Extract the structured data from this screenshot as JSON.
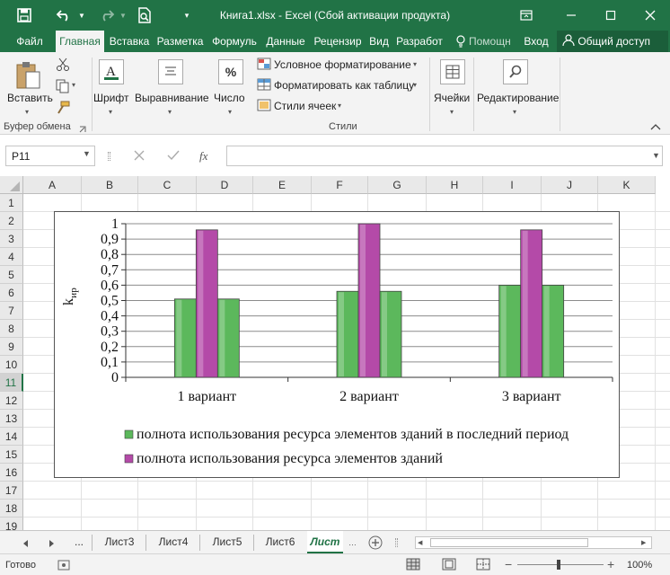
{
  "window": {
    "title": "Книга1.xlsx - Excel (Сбой активации продукта)"
  },
  "ribbon_tabs": [
    "Файл",
    "Главная",
    "Вставка",
    "Разметка",
    "Формуль",
    "Данные",
    "Рецензир",
    "Вид",
    "Разработ",
    "Помощн",
    "Вход"
  ],
  "share_label": "Общий доступ",
  "ribbon": {
    "paste_label": "Вставить",
    "clipboard_group": "Буфер обмена",
    "font_label": "Шрифт",
    "align_label": "Выравнивание",
    "number_label": "Число",
    "cond_format": "Условное форматирование",
    "format_table": "Форматировать как таблицу",
    "cell_styles": "Стили ячеек",
    "styles_group": "Стили",
    "cells_label": "Ячейки",
    "editing_label": "Редактирование"
  },
  "formula_bar": {
    "name_box": "P11",
    "fx": "fx",
    "formula": ""
  },
  "columns": [
    "A",
    "B",
    "C",
    "D",
    "E",
    "F",
    "G",
    "H",
    "I",
    "J",
    "K"
  ],
  "rows": [
    "1",
    "2",
    "3",
    "4",
    "5",
    "6",
    "7",
    "8",
    "9",
    "10",
    "11",
    "12",
    "13",
    "14",
    "15",
    "16",
    "17",
    "18",
    "19"
  ],
  "selected_row": "11",
  "chart_data": {
    "type": "bar",
    "categories": [
      "1 вариант",
      "2 вариант",
      "3 вариант"
    ],
    "series": [
      {
        "name": "полнота использования ресурса элементов зданий в последний период",
        "values": [
          0.51,
          0.56,
          0.6
        ],
        "color": "#5cb85c"
      },
      {
        "name": "полнота использования ресурса элементов зданий",
        "values": [
          0.96,
          1.0,
          0.96
        ],
        "color": "#b44aa8"
      }
    ],
    "ylim": [
      0,
      1
    ],
    "yticks": [
      "0",
      "0,1",
      "0,2",
      "0,3",
      "0,4",
      "0,5",
      "0,6",
      "0,7",
      "0,8",
      "0,9",
      "1"
    ],
    "ylabel": "k",
    "ylabel_sub": "ир",
    "grid": true,
    "legend": "bottom"
  },
  "sheets": [
    "...",
    "Лист3",
    "Лист4",
    "Лист5",
    "Лист6",
    "Лист"
  ],
  "active_sheet": "Лист",
  "status": {
    "ready": "Готово",
    "zoom": "100%"
  }
}
